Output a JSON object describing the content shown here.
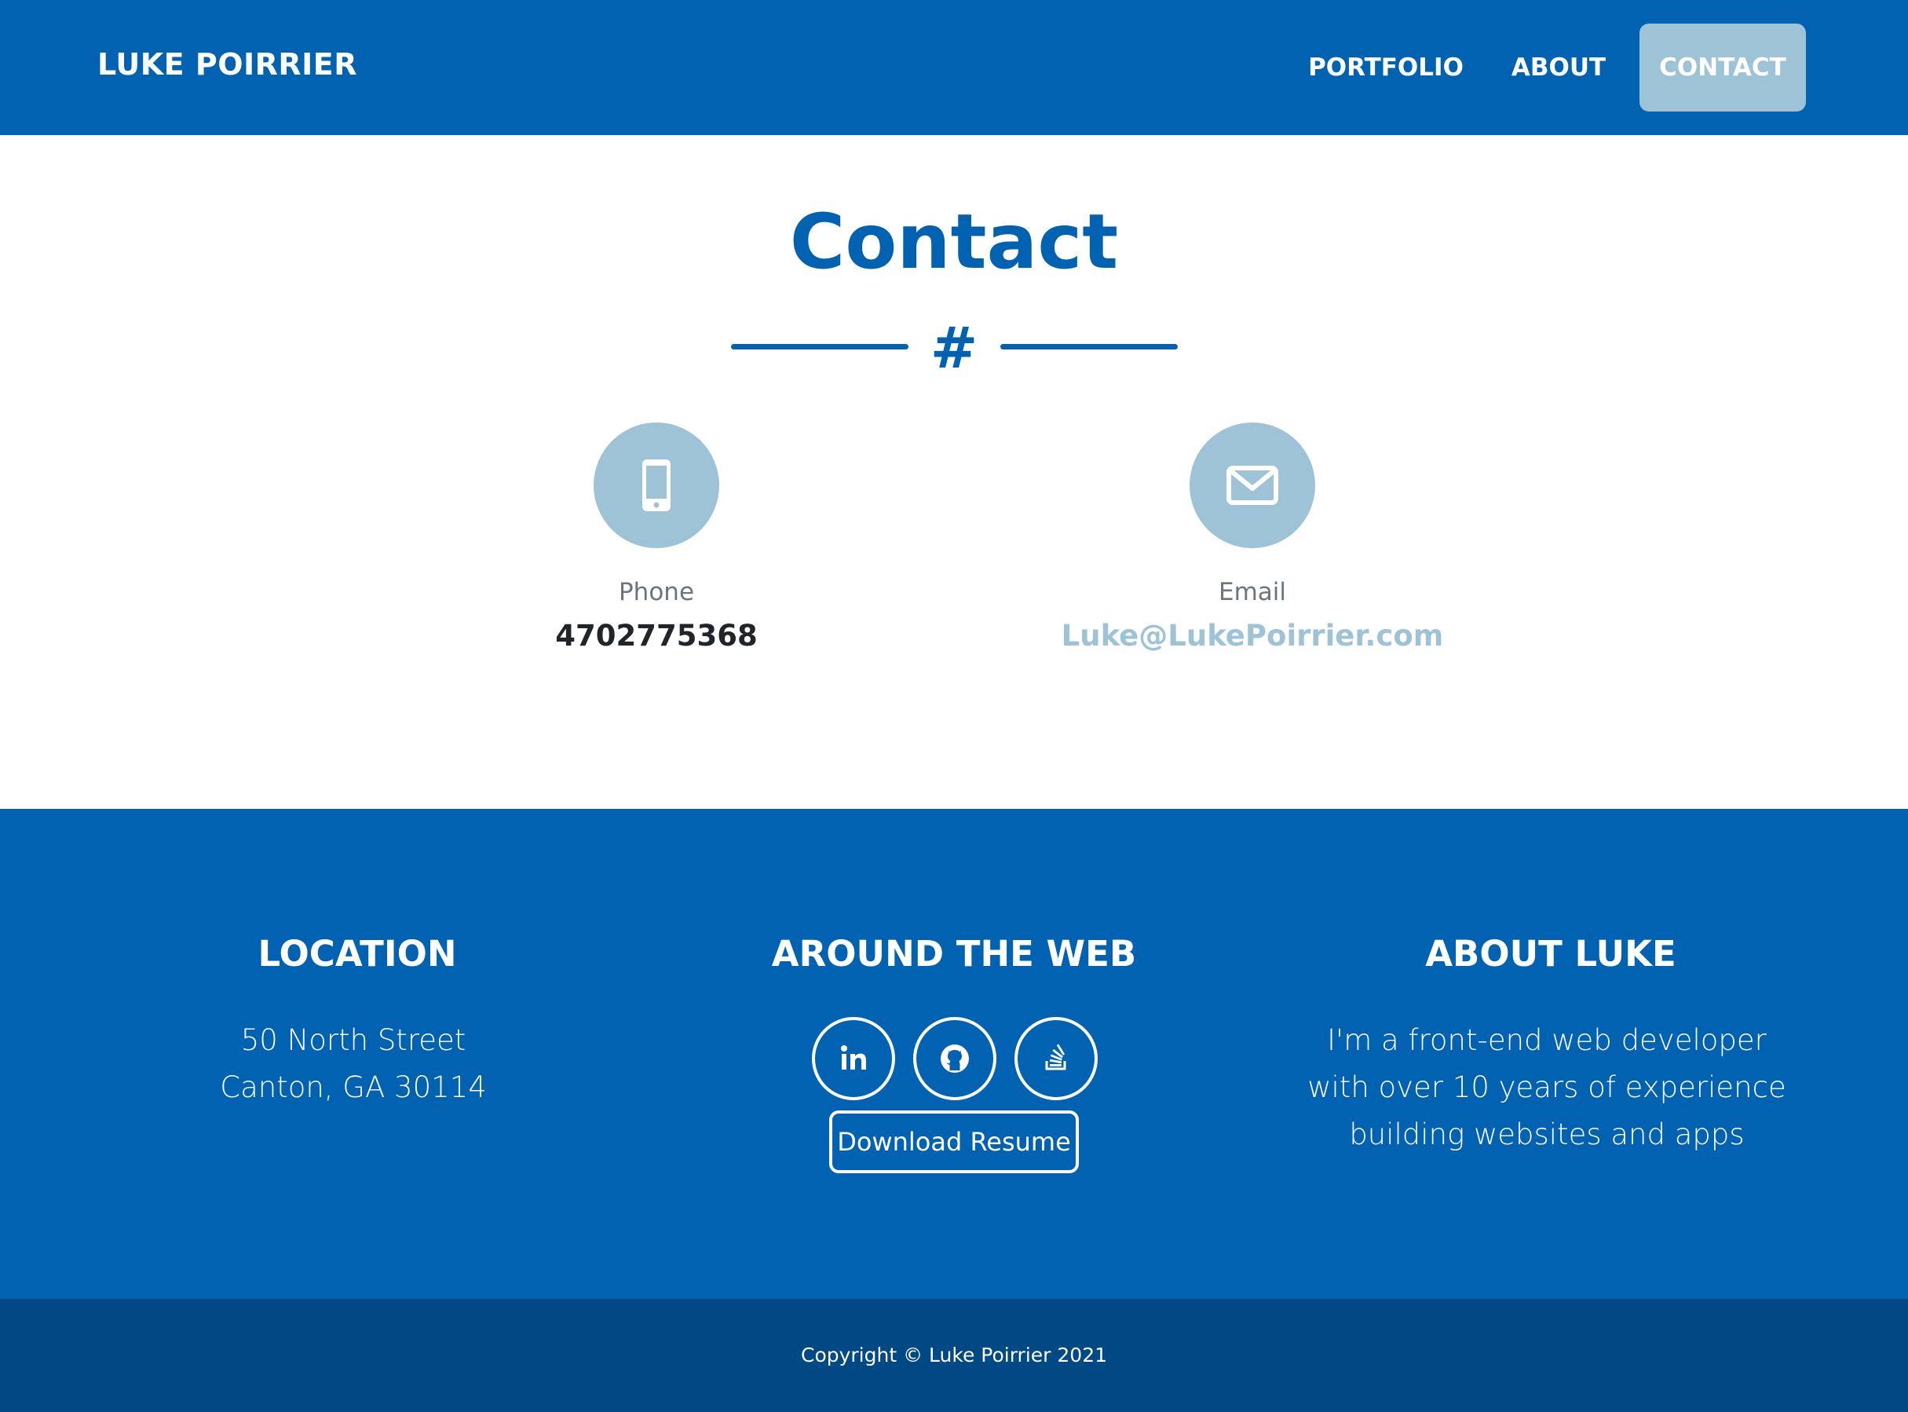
{
  "navbar": {
    "brand": "LUKE POIRRIER",
    "links": [
      {
        "label": "PORTFOLIO",
        "active": false
      },
      {
        "label": "ABOUT",
        "active": false
      },
      {
        "label": "CONTACT",
        "active": true
      }
    ]
  },
  "contact": {
    "title": "Contact",
    "divider_glyph": "#",
    "phone": {
      "label": "Phone",
      "value": "4702775368",
      "icon": "mobile-phone-icon"
    },
    "email": {
      "label": "Email",
      "value": "Luke@LukePoirrier.com",
      "icon": "envelope-icon"
    }
  },
  "footer": {
    "location": {
      "heading": "LOCATION",
      "lines": [
        "50 North Street",
        "Canton, GA 30114"
      ]
    },
    "web": {
      "heading": "AROUND THE WEB",
      "social": [
        {
          "name": "linkedin",
          "icon": "linkedin-icon"
        },
        {
          "name": "github",
          "icon": "github-icon"
        },
        {
          "name": "stack-overflow",
          "icon": "stack-overflow-icon"
        }
      ],
      "resume_button": "Download Resume"
    },
    "about": {
      "heading": "ABOUT LUKE",
      "text": "I'm a front-end web developer with over 10 years of experience building websites and apps"
    }
  },
  "copyright": "Copyright © Luke Poirrier 2021",
  "colors": {
    "primary": "#0162b2",
    "accent": "#9ec3d7",
    "footer_dark": "#004985",
    "text_dark": "#212529",
    "text_muted": "#6c757d"
  }
}
